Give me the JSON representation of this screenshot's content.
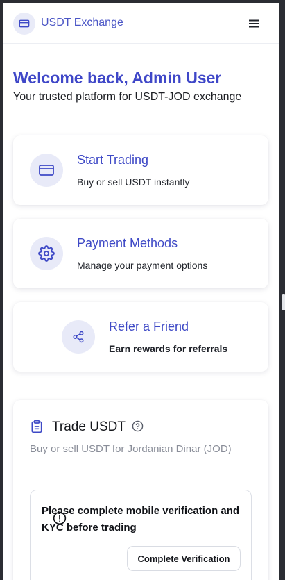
{
  "header": {
    "brand": "USDT Exchange",
    "logo_icon": "credit-card-icon",
    "menu_icon": "hamburger-menu-icon"
  },
  "hero": {
    "welcome": "Welcome back, Admin User",
    "tagline": "Your trusted platform for USDT-JOD exchange"
  },
  "actions": [
    {
      "title": "Start Trading",
      "desc": "Buy or sell USDT instantly",
      "icon": "credit-card-icon"
    },
    {
      "title": "Payment Methods",
      "desc": "Manage your payment options",
      "icon": "gear-icon"
    },
    {
      "title": "Refer a Friend",
      "desc": "Earn rewards for referrals",
      "icon": "share-icon"
    }
  ],
  "trade": {
    "title": "Trade USDT",
    "subtitle": "Buy or sell USDT for Jordanian Dinar (JOD)",
    "icon": "clipboard-icon",
    "help_icon": "help-circle-icon",
    "notice": "Please complete mobile verification and KYC before trading",
    "notice_icon": "alert-circle-icon",
    "verify_button": "Complete Verification"
  },
  "colors": {
    "accent": "#3f47c8",
    "accent_light": "#e8eaf8",
    "background": "#ffffff",
    "frame": "#2b2d33"
  }
}
